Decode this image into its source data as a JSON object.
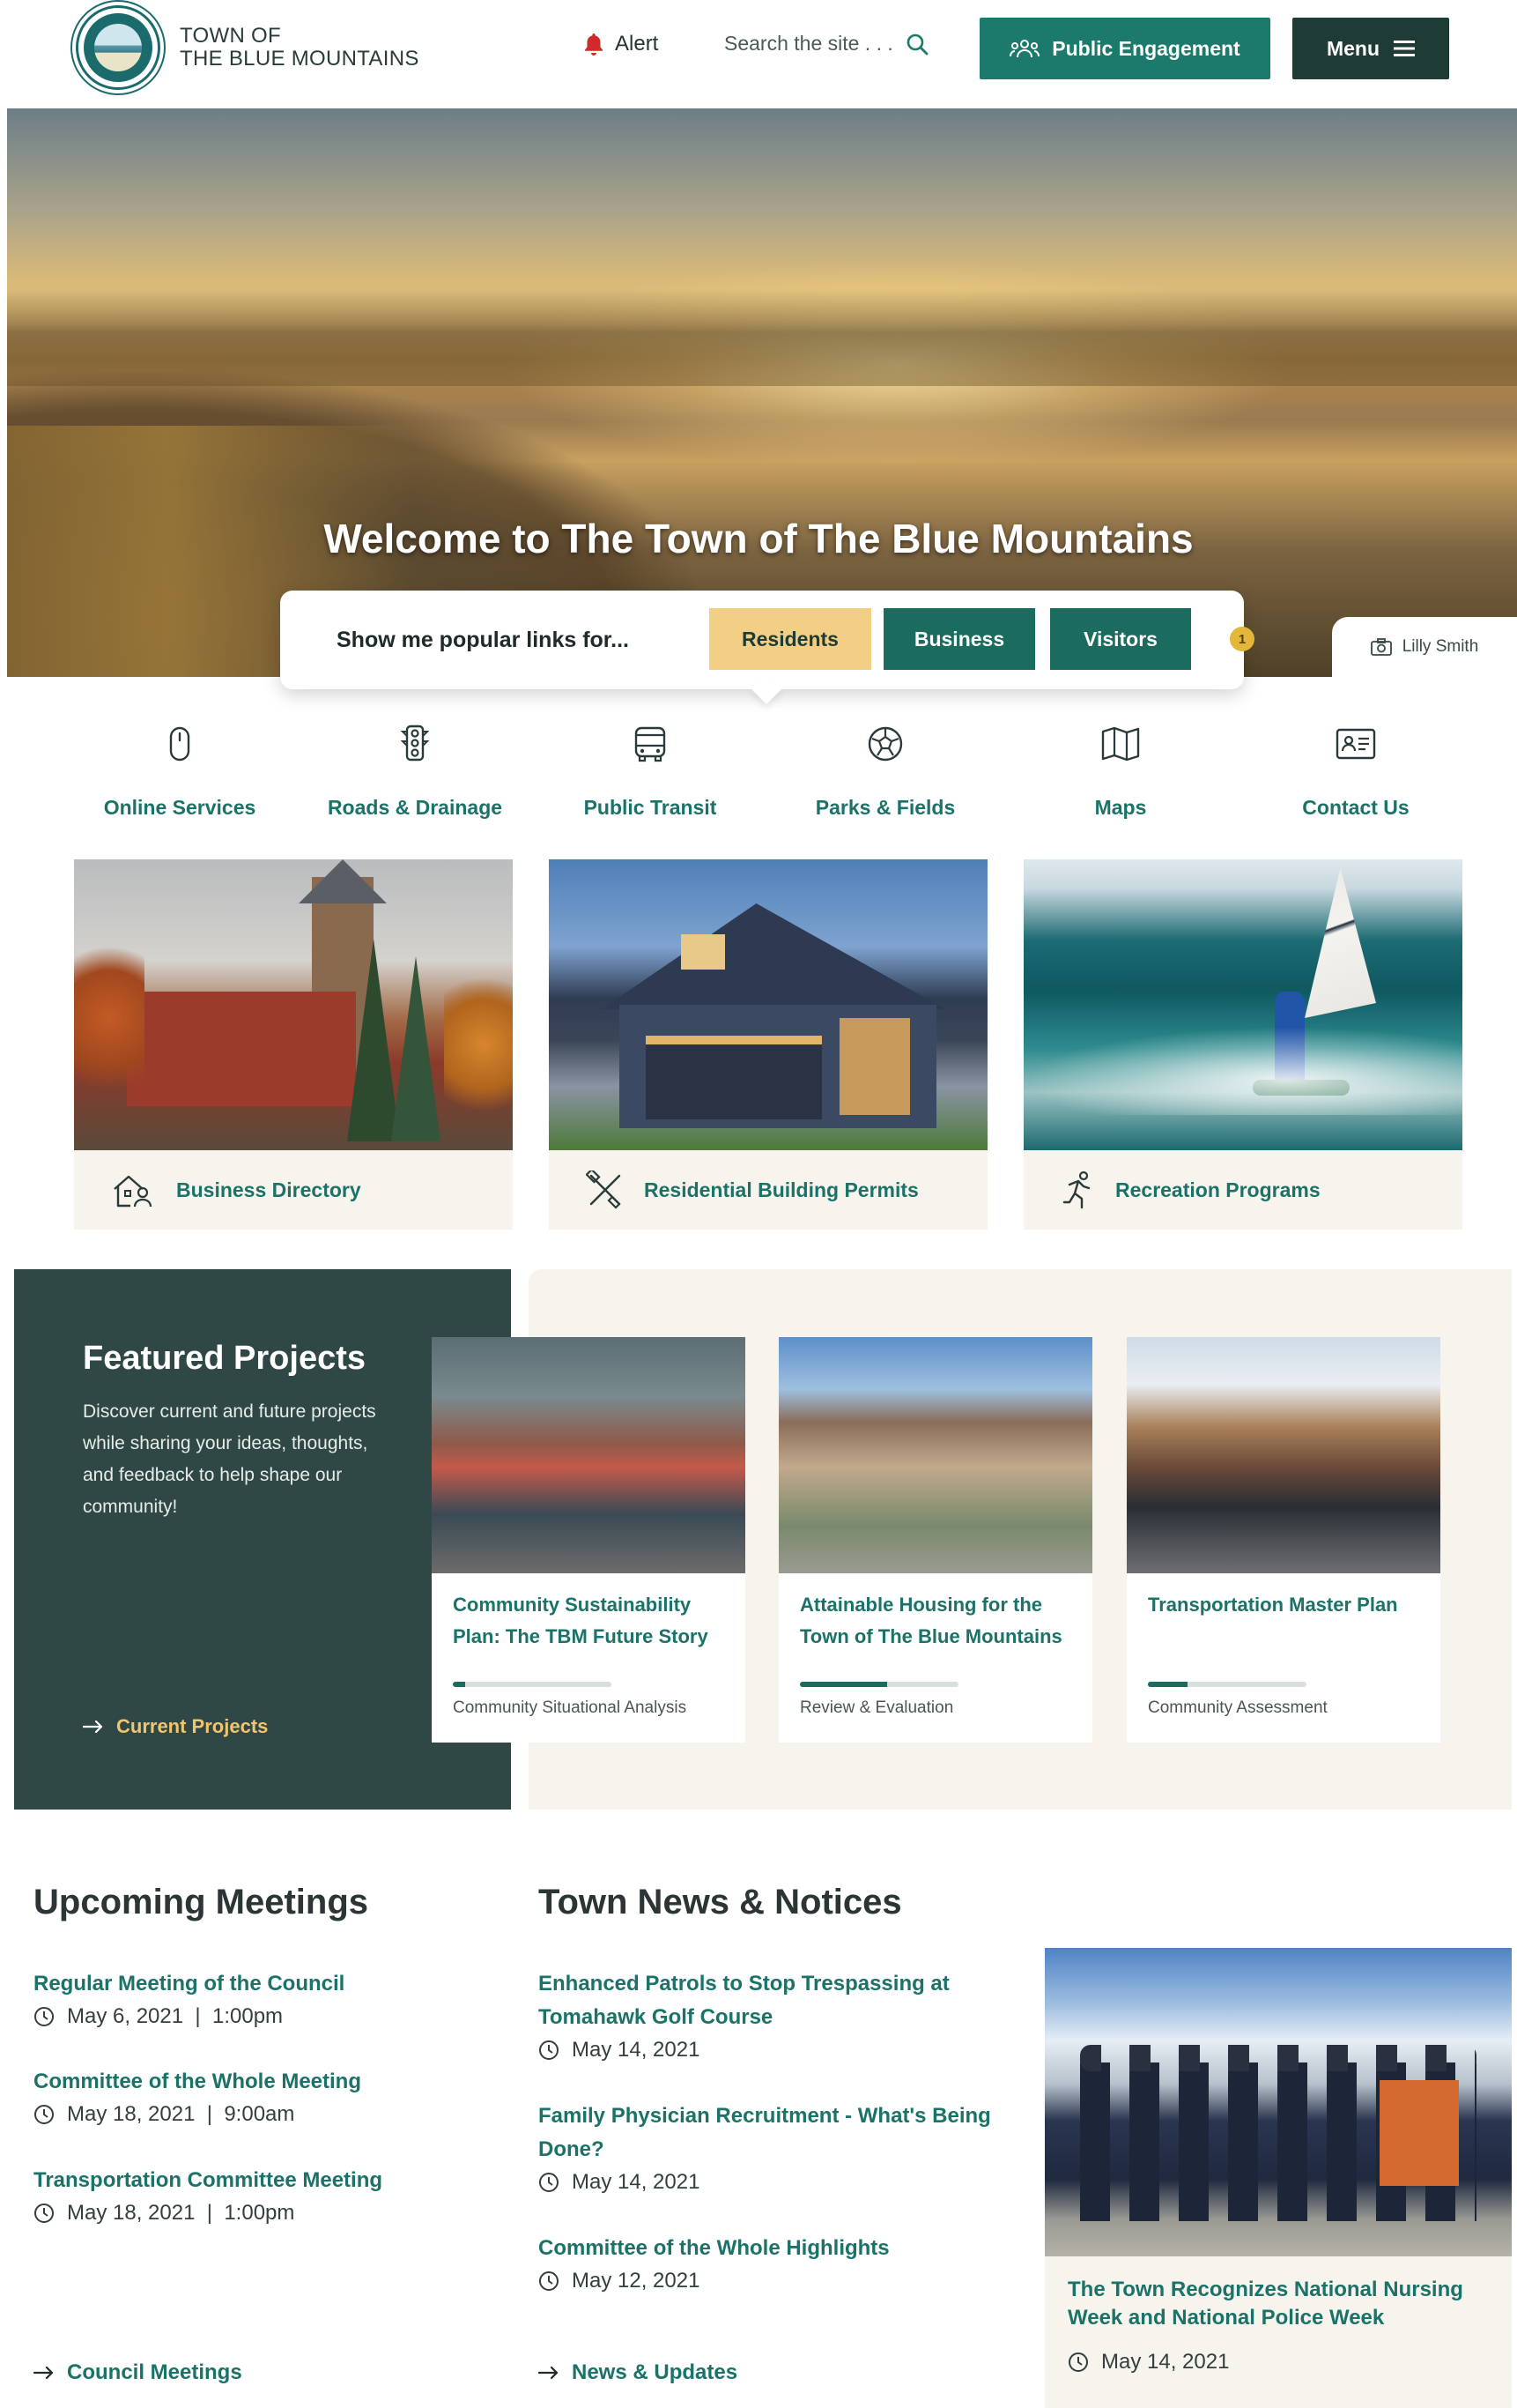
{
  "header": {
    "logo_line1": "TOWN OF",
    "logo_line2": "THE BLUE MOUNTAINS",
    "alert_label": "Alert",
    "search_placeholder": "Search the site . . .",
    "engage_label": "Public Engagement",
    "menu_label": "Menu"
  },
  "hero": {
    "title": "Welcome to The Town of The Blue Mountains",
    "photo_credit": "Lilly Smith",
    "popular_label": "Show me popular links for...",
    "audiences": [
      "Residents",
      "Business",
      "Visitors"
    ],
    "badge": "1"
  },
  "quick_links": [
    {
      "label": "Online Services",
      "icon": "mouse-icon"
    },
    {
      "label": "Roads & Drainage",
      "icon": "traffic-light-icon"
    },
    {
      "label": "Public Transit",
      "icon": "bus-icon"
    },
    {
      "label": "Parks & Fields",
      "icon": "soccer-ball-icon"
    },
    {
      "label": "Maps",
      "icon": "map-icon"
    },
    {
      "label": "Contact Us",
      "icon": "contact-card-icon"
    }
  ],
  "feature_cards": [
    {
      "label": "Business Directory",
      "icon": "business-directory-icon"
    },
    {
      "label": "Residential Building Permits",
      "icon": "building-permits-icon"
    },
    {
      "label": "Recreation Programs",
      "icon": "recreation-icon"
    }
  ],
  "featured_projects": {
    "title": "Featured Projects",
    "description": "Discover current and future projects while sharing your ideas, thoughts, and feedback to help shape our community!",
    "link": "Current Projects",
    "projects": [
      {
        "title": "Community Sustainability Plan: The TBM Future Story",
        "stage": "Community Situational Analysis",
        "progress": 0.08
      },
      {
        "title": "Attainable Housing for the Town of The Blue Mountains",
        "stage": "Review & Evaluation",
        "progress": 0.55
      },
      {
        "title": "Transportation Master Plan",
        "stage": "Community Assessment",
        "progress": 0.25
      }
    ]
  },
  "meetings": {
    "title": "Upcoming Meetings",
    "items": [
      {
        "title": "Regular Meeting of the Council",
        "date": "May 6, 2021  |  1:00pm"
      },
      {
        "title": "Committee of the Whole Meeting",
        "date": "May 18, 2021  |  9:00am"
      },
      {
        "title": "Transportation Committee Meeting",
        "date": "May 18, 2021  |  1:00pm"
      }
    ],
    "link": "Council Meetings"
  },
  "news": {
    "title": "Town News & Notices",
    "items": [
      {
        "title": "Enhanced Patrols to Stop Trespassing at Tomahawk Golf Course",
        "date": "May 14, 2021"
      },
      {
        "title": "Family Physician Recruitment - What's Being Done?",
        "date": "May 14, 2021"
      },
      {
        "title": "Committee of the Whole Highlights",
        "date": "May 12, 2021"
      }
    ],
    "link": "News & Updates",
    "feature": {
      "title": "The Town Recognizes National Nursing Week and National Police Week",
      "date": "May 14, 2021"
    }
  },
  "colors": {
    "accent": "#1b7268",
    "dark": "#2f4845",
    "gold": "#f3cf85",
    "cream": "#f6f4ec"
  }
}
